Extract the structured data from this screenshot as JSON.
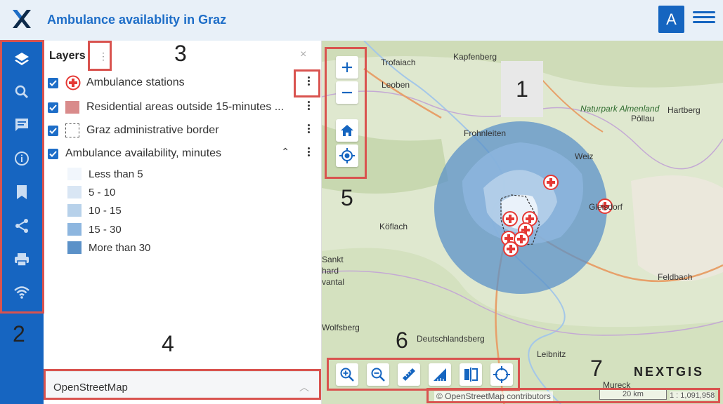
{
  "header": {
    "title": "Ambulance availablity in Graz",
    "avatar_letter": "A"
  },
  "rail": {
    "items": [
      "layers-icon",
      "search-icon",
      "chat-icon",
      "info-icon",
      "bookmark-icon",
      "share-icon",
      "print-icon",
      "wifi-icon"
    ]
  },
  "panel": {
    "title": "Layers",
    "close": "×",
    "layers": [
      {
        "label": "Ambulance stations"
      },
      {
        "label": "Residential areas outside 15-minutes ..."
      },
      {
        "label": "Graz administrative border"
      },
      {
        "label": "Ambulance availability, minutes"
      }
    ],
    "legend": [
      {
        "label": "Less than 5",
        "color": "#f1f6fc"
      },
      {
        "label": "5 - 10",
        "color": "#d9e6f4"
      },
      {
        "label": "10 - 15",
        "color": "#b7d1ea"
      },
      {
        "label": "15 - 30",
        "color": "#8db6df"
      },
      {
        "label": "More than 30",
        "color": "#5b91c8"
      }
    ],
    "basemap": "OpenStreetMap"
  },
  "map": {
    "places": [
      "Trofaiach",
      "Kapfenberg",
      "Leoben",
      "Naturpark Almenland",
      "Pöllau",
      "Hartberg",
      "Frohnleiten",
      "Weiz",
      "Gleisdorf",
      "Köflach",
      "Sankt",
      "hard",
      "vantal",
      "Feldbach",
      "Wolfsberg",
      "Deutschlandsberg",
      "Leibnitz",
      "Mureck"
    ],
    "attribution": "© OpenStreetMap contributors",
    "scale": "20 km",
    "scale_ratio": "1 : 1,091,958",
    "brand": "NEXTGIS"
  },
  "annotations": [
    "1",
    "2",
    "3",
    "4",
    "5",
    "6",
    "7"
  ],
  "colors": {
    "primary": "#1665c1",
    "callout": "#d9534f",
    "station": "#e53935",
    "residential": "#d98b8b"
  }
}
